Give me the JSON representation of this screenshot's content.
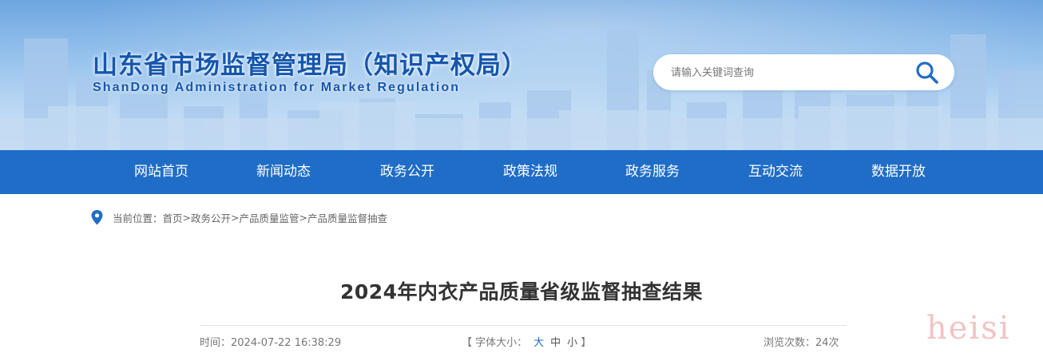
{
  "header": {
    "title": "山东省市场监督管理局（知识产权局）",
    "subtitle": "ShanDong Administration for Market Regulation"
  },
  "search": {
    "placeholder": "请输入关键词查询",
    "icon": "search-icon"
  },
  "nav": {
    "items": [
      {
        "label": "网站首页"
      },
      {
        "label": "新闻动态"
      },
      {
        "label": "政务公开"
      },
      {
        "label": "政策法规"
      },
      {
        "label": "政务服务"
      },
      {
        "label": "互动交流"
      },
      {
        "label": "数据开放"
      }
    ]
  },
  "breadcrumb": {
    "icon": "location-pin-icon",
    "prefix": "当前位置：",
    "separator": ">",
    "items": [
      "首页",
      "政务公开",
      "产品质量监管",
      "产品质量监督抽查"
    ]
  },
  "article": {
    "title": "2024年内衣产品质量省级监督抽查结果",
    "time_label": "时间：",
    "time": "2024-07-22 16:38:29",
    "font_size": {
      "open": "【 字体大小：",
      "large": "大",
      "medium": "中",
      "small": "小",
      "close": "】"
    },
    "views_label": "浏览次数：",
    "views": "24次"
  },
  "watermark": "heisi",
  "colors": {
    "brand_blue": "#1556ad",
    "nav_blue": "#1f6dc6"
  }
}
